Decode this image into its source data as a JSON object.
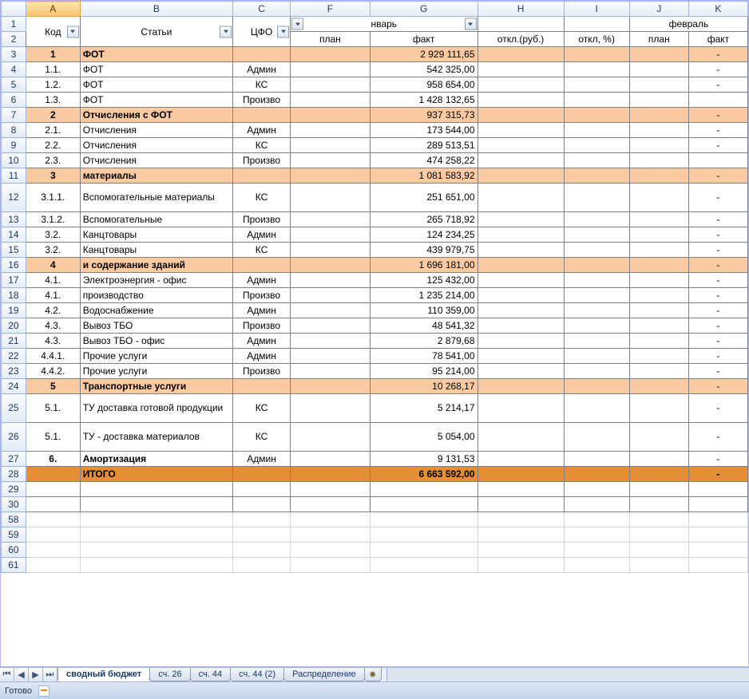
{
  "column_letters": [
    "A",
    "B",
    "C",
    "F",
    "G",
    "H",
    "I",
    "J",
    "K"
  ],
  "row_numbers": [
    "1",
    "2",
    "3",
    "4",
    "5",
    "6",
    "7",
    "8",
    "9",
    "10",
    "11",
    "12",
    "13",
    "14",
    "15",
    "16",
    "17",
    "18",
    "19",
    "20",
    "21",
    "22",
    "23",
    "24",
    "25",
    "26",
    "27",
    "28",
    "29",
    "30",
    "58",
    "59",
    "60",
    "61"
  ],
  "headers_row1": {
    "A": "Код",
    "B": "Статьи",
    "C": "ЦФО",
    "G": "нварь",
    "JK": "февраль"
  },
  "headers_row2": {
    "F": "план",
    "G": "факт",
    "H": "откл.(руб.)",
    "I": "откл, %)",
    "J": "план",
    "K": "факт"
  },
  "rows": [
    {
      "n": "3",
      "grp": true,
      "A": "1",
      "B": "ФОТ",
      "G": "2 929 111,65",
      "K": "-"
    },
    {
      "n": "4",
      "A": "1.1.",
      "B": "ФОТ",
      "C": "Админ",
      "G": "542 325,00",
      "K": "-"
    },
    {
      "n": "5",
      "A": "1.2.",
      "B": "ФОТ",
      "C": "КС",
      "G": "958 654,00",
      "K": "-"
    },
    {
      "n": "6",
      "A": "1.3.",
      "B": "ФОТ",
      "C": "Произво",
      "G": "1 428 132,65",
      "K": ""
    },
    {
      "n": "7",
      "grp": true,
      "A": "2",
      "B": "Отчисления с ФОТ",
      "G": "937 315,73",
      "K": "-"
    },
    {
      "n": "8",
      "A": "2.1.",
      "B": "Отчисления",
      "C": "Админ",
      "G": "173 544,00",
      "K": "-"
    },
    {
      "n": "9",
      "A": "2.2.",
      "B": "Отчисления",
      "C": "КС",
      "G": "289 513,51",
      "K": "-"
    },
    {
      "n": "10",
      "A": "2.3.",
      "B": "Отчисления",
      "C": "Произво",
      "G": "474 258,22",
      "K": ""
    },
    {
      "n": "11",
      "grp": true,
      "A": "3",
      "B": "материалы",
      "G": "1 081 583,92",
      "K": "-"
    },
    {
      "n": "12",
      "tall": true,
      "A": "3.1.1.",
      "B": "Вспомогательные материалы",
      "C": "КС",
      "G": "251 651,00",
      "K": "-"
    },
    {
      "n": "13",
      "A": "3.1.2.",
      "B": "Вспомогательные",
      "C": "Произво",
      "G": "265 718,92",
      "K": "-"
    },
    {
      "n": "14",
      "A": "3.2.",
      "B": "Канцтовары",
      "C": "Админ",
      "G": "124 234,25",
      "K": "-"
    },
    {
      "n": "15",
      "A": "3.2.",
      "B": "Канцтовары",
      "C": "КС",
      "G": "439 979,75",
      "K": "-"
    },
    {
      "n": "16",
      "grp": true,
      "A": "4",
      "B": "и содержание зданий",
      "G": "1 696 181,00",
      "K": "-"
    },
    {
      "n": "17",
      "A": "4.1.",
      "B": "Электроэнергия - офис",
      "C": "Админ",
      "G": "125 432,00",
      "K": "-"
    },
    {
      "n": "18",
      "A": "4.1.",
      "B": "производство",
      "C": "Произво",
      "G": "1 235 214,00",
      "K": "-"
    },
    {
      "n": "19",
      "A": "4.2.",
      "B": "Водоснабжение",
      "C": "Админ",
      "G": "110 359,00",
      "K": "-"
    },
    {
      "n": "20",
      "A": "4.3.",
      "B": "Вывоз ТБО",
      "C": "Произво",
      "G": "48 541,32",
      "K": "-"
    },
    {
      "n": "21",
      "A": "4.3.",
      "B": "Вывоз ТБО - офис",
      "C": "Админ",
      "G": "2 879,68",
      "K": "-"
    },
    {
      "n": "22",
      "A": "4.4.1.",
      "B": "Прочие услуги",
      "C": "Админ",
      "G": "78 541,00",
      "K": "-"
    },
    {
      "n": "23",
      "A": "4.4.2.",
      "B": "Прочие услуги",
      "C": "Произво",
      "G": "95 214,00",
      "K": "-"
    },
    {
      "n": "24",
      "grp": true,
      "A": "5",
      "B": "Транспортные услуги",
      "G": "10 268,17",
      "K": "-"
    },
    {
      "n": "25",
      "tall": true,
      "A": "5.1.",
      "B": "ТУ доставка готовой продукции",
      "C": "КС",
      "G": "5 214,17",
      "K": "-"
    },
    {
      "n": "26",
      "tall": true,
      "A": "5.1.",
      "B": "ТУ - доставка материалов",
      "C": "КС",
      "G": "5 054,00",
      "K": "-"
    },
    {
      "n": "27",
      "bold": true,
      "A": "6.",
      "B": "Амортизация",
      "C": "Админ",
      "G": "9 131,53",
      "K": "-"
    },
    {
      "n": "28",
      "total": true,
      "B": "ИТОГО",
      "G": "6 663 592,00",
      "K": "-"
    }
  ],
  "empty_rows_dark": [
    "29",
    "30"
  ],
  "empty_rows_plain": [
    "58",
    "59",
    "60",
    "61"
  ],
  "tabs": [
    "сводный бюджет",
    "сч. 26",
    "сч. 44",
    "сч. 44 (2)",
    "Распределение"
  ],
  "active_tab": 0,
  "status": "Готово",
  "nav_glyphs": [
    "⏮",
    "◀",
    "▶",
    "⏭"
  ],
  "insert_glyph": "✸"
}
